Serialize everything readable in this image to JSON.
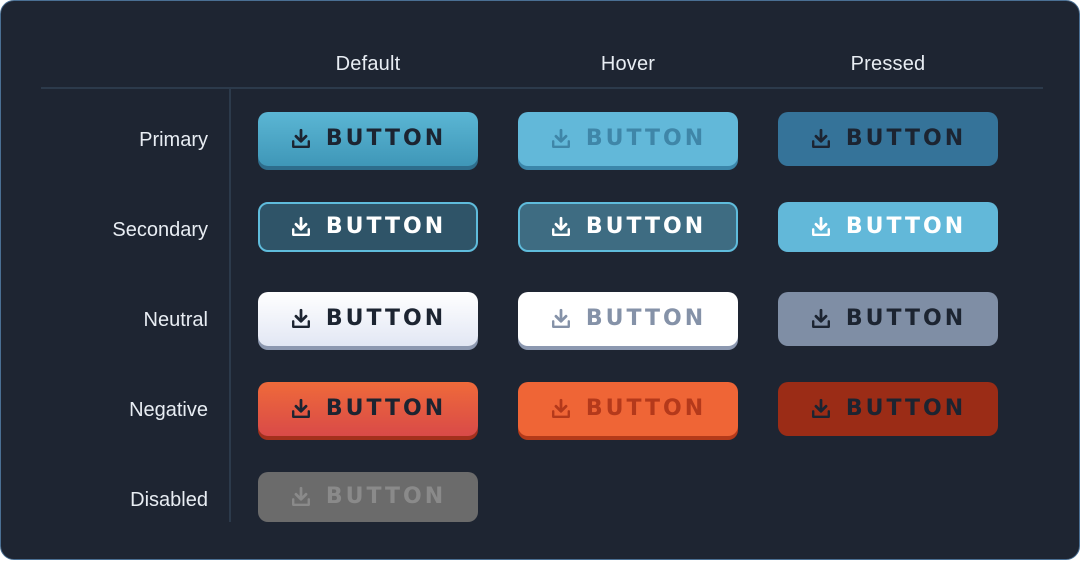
{
  "columns": {
    "default": "Default",
    "hover": "Hover",
    "pressed": "Pressed"
  },
  "rows": {
    "primary": "Primary",
    "secondary": "Secondary",
    "neutral": "Neutral",
    "negative": "Negative",
    "disabled": "Disabled"
  },
  "button_label": "BUTTON",
  "button_icon": "download-icon",
  "colors": {
    "panel_bg": "#1e2532",
    "panel_border": "#4a6f93",
    "divider": "#2c3a4b",
    "primary_default": "#4aa8c8",
    "primary_hover": "#62b8d9",
    "primary_pressed": "#357399",
    "secondary_default": "#2f5468",
    "secondary_hover": "#3e6c82",
    "secondary_pressed": "#62b8d9",
    "neutral_default": "#eef1f8",
    "neutral_hover": "#ffffff",
    "neutral_pressed": "#7f8ea5",
    "negative_default": "#e65845",
    "negative_hover": "#ef6536",
    "negative_pressed": "#9b2c16",
    "disabled": "#6b6b6b"
  }
}
